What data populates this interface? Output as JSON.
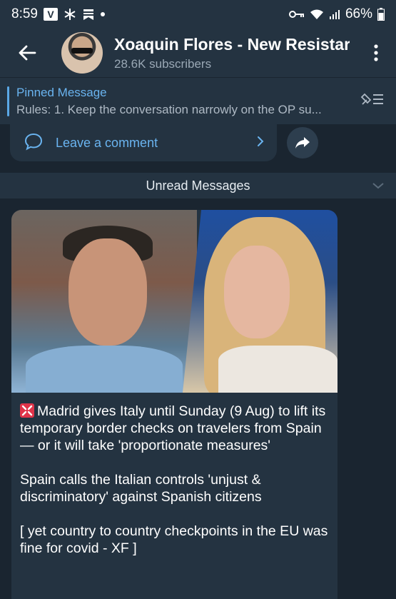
{
  "status_bar": {
    "time": "8:59",
    "battery": "66%",
    "icons": [
      "v-app-icon",
      "asterisk-icon",
      "news-icon",
      "dot-icon",
      "key-icon",
      "wifi-icon",
      "signal-icon",
      "battery-icon"
    ]
  },
  "header": {
    "title": "Xoaquin Flores - New Resistar",
    "subscribers": "28.6K subscribers"
  },
  "pinned": {
    "title": "Pinned Message",
    "text": "Rules: 1. Keep the conversation narrowly on the OP su..."
  },
  "comment": {
    "label": "Leave a comment"
  },
  "unread": {
    "label": "Unread Messages"
  },
  "message": {
    "paragraph1": "Madrid gives Italy until Sunday (9 Aug) to lift its temporary border checks on travelers from Spain — or it will take 'proportionate measures'",
    "paragraph2": "Spain calls the Italian controls 'unjust & discriminatory' against Spanish citizens",
    "paragraph3": "[ yet country to country checkpoints in the EU was fine for covid - XF ]"
  },
  "colors": {
    "background": "#1a2530",
    "panel": "#243341",
    "accent": "#6ab4f0",
    "alert_emoji": "#e0344a"
  }
}
